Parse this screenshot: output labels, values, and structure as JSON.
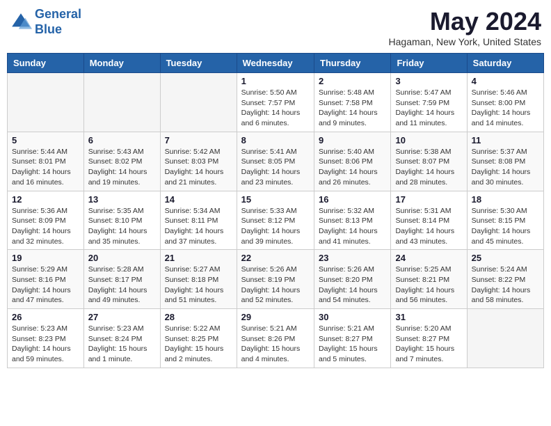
{
  "header": {
    "logo_line1": "General",
    "logo_line2": "Blue",
    "month_title": "May 2024",
    "location": "Hagaman, New York, United States"
  },
  "days_of_week": [
    "Sunday",
    "Monday",
    "Tuesday",
    "Wednesday",
    "Thursday",
    "Friday",
    "Saturday"
  ],
  "weeks": [
    [
      {
        "num": "",
        "sunrise": "",
        "sunset": "",
        "daylight": "",
        "empty": true
      },
      {
        "num": "",
        "sunrise": "",
        "sunset": "",
        "daylight": "",
        "empty": true
      },
      {
        "num": "",
        "sunrise": "",
        "sunset": "",
        "daylight": "",
        "empty": true
      },
      {
        "num": "1",
        "sunrise": "Sunrise: 5:50 AM",
        "sunset": "Sunset: 7:57 PM",
        "daylight": "Daylight: 14 hours and 6 minutes.",
        "empty": false
      },
      {
        "num": "2",
        "sunrise": "Sunrise: 5:48 AM",
        "sunset": "Sunset: 7:58 PM",
        "daylight": "Daylight: 14 hours and 9 minutes.",
        "empty": false
      },
      {
        "num": "3",
        "sunrise": "Sunrise: 5:47 AM",
        "sunset": "Sunset: 7:59 PM",
        "daylight": "Daylight: 14 hours and 11 minutes.",
        "empty": false
      },
      {
        "num": "4",
        "sunrise": "Sunrise: 5:46 AM",
        "sunset": "Sunset: 8:00 PM",
        "daylight": "Daylight: 14 hours and 14 minutes.",
        "empty": false
      }
    ],
    [
      {
        "num": "5",
        "sunrise": "Sunrise: 5:44 AM",
        "sunset": "Sunset: 8:01 PM",
        "daylight": "Daylight: 14 hours and 16 minutes.",
        "empty": false
      },
      {
        "num": "6",
        "sunrise": "Sunrise: 5:43 AM",
        "sunset": "Sunset: 8:02 PM",
        "daylight": "Daylight: 14 hours and 19 minutes.",
        "empty": false
      },
      {
        "num": "7",
        "sunrise": "Sunrise: 5:42 AM",
        "sunset": "Sunset: 8:03 PM",
        "daylight": "Daylight: 14 hours and 21 minutes.",
        "empty": false
      },
      {
        "num": "8",
        "sunrise": "Sunrise: 5:41 AM",
        "sunset": "Sunset: 8:05 PM",
        "daylight": "Daylight: 14 hours and 23 minutes.",
        "empty": false
      },
      {
        "num": "9",
        "sunrise": "Sunrise: 5:40 AM",
        "sunset": "Sunset: 8:06 PM",
        "daylight": "Daylight: 14 hours and 26 minutes.",
        "empty": false
      },
      {
        "num": "10",
        "sunrise": "Sunrise: 5:38 AM",
        "sunset": "Sunset: 8:07 PM",
        "daylight": "Daylight: 14 hours and 28 minutes.",
        "empty": false
      },
      {
        "num": "11",
        "sunrise": "Sunrise: 5:37 AM",
        "sunset": "Sunset: 8:08 PM",
        "daylight": "Daylight: 14 hours and 30 minutes.",
        "empty": false
      }
    ],
    [
      {
        "num": "12",
        "sunrise": "Sunrise: 5:36 AM",
        "sunset": "Sunset: 8:09 PM",
        "daylight": "Daylight: 14 hours and 32 minutes.",
        "empty": false
      },
      {
        "num": "13",
        "sunrise": "Sunrise: 5:35 AM",
        "sunset": "Sunset: 8:10 PM",
        "daylight": "Daylight: 14 hours and 35 minutes.",
        "empty": false
      },
      {
        "num": "14",
        "sunrise": "Sunrise: 5:34 AM",
        "sunset": "Sunset: 8:11 PM",
        "daylight": "Daylight: 14 hours and 37 minutes.",
        "empty": false
      },
      {
        "num": "15",
        "sunrise": "Sunrise: 5:33 AM",
        "sunset": "Sunset: 8:12 PM",
        "daylight": "Daylight: 14 hours and 39 minutes.",
        "empty": false
      },
      {
        "num": "16",
        "sunrise": "Sunrise: 5:32 AM",
        "sunset": "Sunset: 8:13 PM",
        "daylight": "Daylight: 14 hours and 41 minutes.",
        "empty": false
      },
      {
        "num": "17",
        "sunrise": "Sunrise: 5:31 AM",
        "sunset": "Sunset: 8:14 PM",
        "daylight": "Daylight: 14 hours and 43 minutes.",
        "empty": false
      },
      {
        "num": "18",
        "sunrise": "Sunrise: 5:30 AM",
        "sunset": "Sunset: 8:15 PM",
        "daylight": "Daylight: 14 hours and 45 minutes.",
        "empty": false
      }
    ],
    [
      {
        "num": "19",
        "sunrise": "Sunrise: 5:29 AM",
        "sunset": "Sunset: 8:16 PM",
        "daylight": "Daylight: 14 hours and 47 minutes.",
        "empty": false
      },
      {
        "num": "20",
        "sunrise": "Sunrise: 5:28 AM",
        "sunset": "Sunset: 8:17 PM",
        "daylight": "Daylight: 14 hours and 49 minutes.",
        "empty": false
      },
      {
        "num": "21",
        "sunrise": "Sunrise: 5:27 AM",
        "sunset": "Sunset: 8:18 PM",
        "daylight": "Daylight: 14 hours and 51 minutes.",
        "empty": false
      },
      {
        "num": "22",
        "sunrise": "Sunrise: 5:26 AM",
        "sunset": "Sunset: 8:19 PM",
        "daylight": "Daylight: 14 hours and 52 minutes.",
        "empty": false
      },
      {
        "num": "23",
        "sunrise": "Sunrise: 5:26 AM",
        "sunset": "Sunset: 8:20 PM",
        "daylight": "Daylight: 14 hours and 54 minutes.",
        "empty": false
      },
      {
        "num": "24",
        "sunrise": "Sunrise: 5:25 AM",
        "sunset": "Sunset: 8:21 PM",
        "daylight": "Daylight: 14 hours and 56 minutes.",
        "empty": false
      },
      {
        "num": "25",
        "sunrise": "Sunrise: 5:24 AM",
        "sunset": "Sunset: 8:22 PM",
        "daylight": "Daylight: 14 hours and 58 minutes.",
        "empty": false
      }
    ],
    [
      {
        "num": "26",
        "sunrise": "Sunrise: 5:23 AM",
        "sunset": "Sunset: 8:23 PM",
        "daylight": "Daylight: 14 hours and 59 minutes.",
        "empty": false
      },
      {
        "num": "27",
        "sunrise": "Sunrise: 5:23 AM",
        "sunset": "Sunset: 8:24 PM",
        "daylight": "Daylight: 15 hours and 1 minute.",
        "empty": false
      },
      {
        "num": "28",
        "sunrise": "Sunrise: 5:22 AM",
        "sunset": "Sunset: 8:25 PM",
        "daylight": "Daylight: 15 hours and 2 minutes.",
        "empty": false
      },
      {
        "num": "29",
        "sunrise": "Sunrise: 5:21 AM",
        "sunset": "Sunset: 8:26 PM",
        "daylight": "Daylight: 15 hours and 4 minutes.",
        "empty": false
      },
      {
        "num": "30",
        "sunrise": "Sunrise: 5:21 AM",
        "sunset": "Sunset: 8:27 PM",
        "daylight": "Daylight: 15 hours and 5 minutes.",
        "empty": false
      },
      {
        "num": "31",
        "sunrise": "Sunrise: 5:20 AM",
        "sunset": "Sunset: 8:27 PM",
        "daylight": "Daylight: 15 hours and 7 minutes.",
        "empty": false
      },
      {
        "num": "",
        "sunrise": "",
        "sunset": "",
        "daylight": "",
        "empty": true
      }
    ]
  ]
}
